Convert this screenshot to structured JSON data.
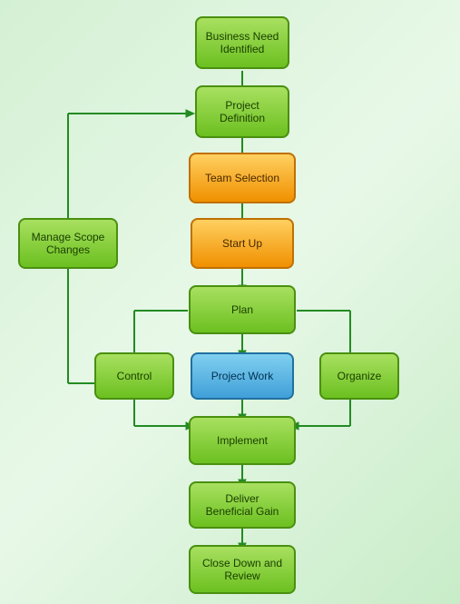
{
  "boxes": {
    "business_need": {
      "label": "Business Need\nIdentified",
      "type": "green"
    },
    "project_definition": {
      "label": "Project\nDefinition",
      "type": "green"
    },
    "team_selection": {
      "label": "Team Selection",
      "type": "orange"
    },
    "start_up": {
      "label": "Start Up",
      "type": "orange"
    },
    "plan": {
      "label": "Plan",
      "type": "green"
    },
    "control": {
      "label": "Control",
      "type": "green"
    },
    "project_work": {
      "label": "Project Work",
      "type": "blue"
    },
    "organize": {
      "label": "Organize",
      "type": "green"
    },
    "implement": {
      "label": "Implement",
      "type": "green"
    },
    "deliver": {
      "label": "Deliver\nBeneficial Gain",
      "type": "green"
    },
    "close_down": {
      "label": "Close Down and\nReview",
      "type": "green"
    },
    "manage_scope": {
      "label": "Manage Scope\nChanges",
      "type": "green"
    }
  }
}
